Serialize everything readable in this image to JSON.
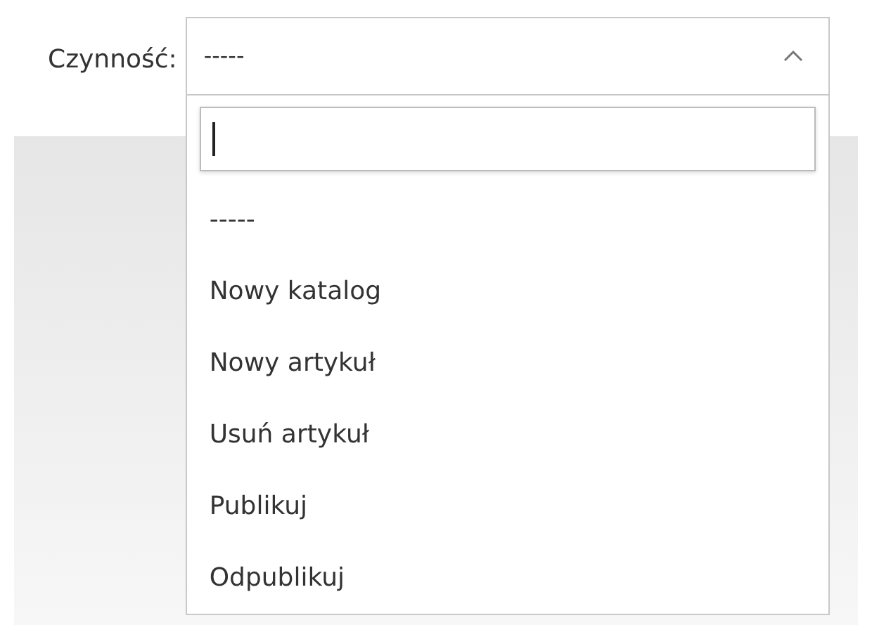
{
  "field": {
    "label": "Czynność:",
    "value": "-----",
    "expanded": true
  },
  "dropdown": {
    "options": [
      {
        "label": "-----"
      },
      {
        "label": "Nowy katalog"
      },
      {
        "label": "Nowy artykuł"
      },
      {
        "label": "Usuń artykuł"
      },
      {
        "label": "Publikuj"
      },
      {
        "label": "Odpublikuj"
      }
    ]
  }
}
